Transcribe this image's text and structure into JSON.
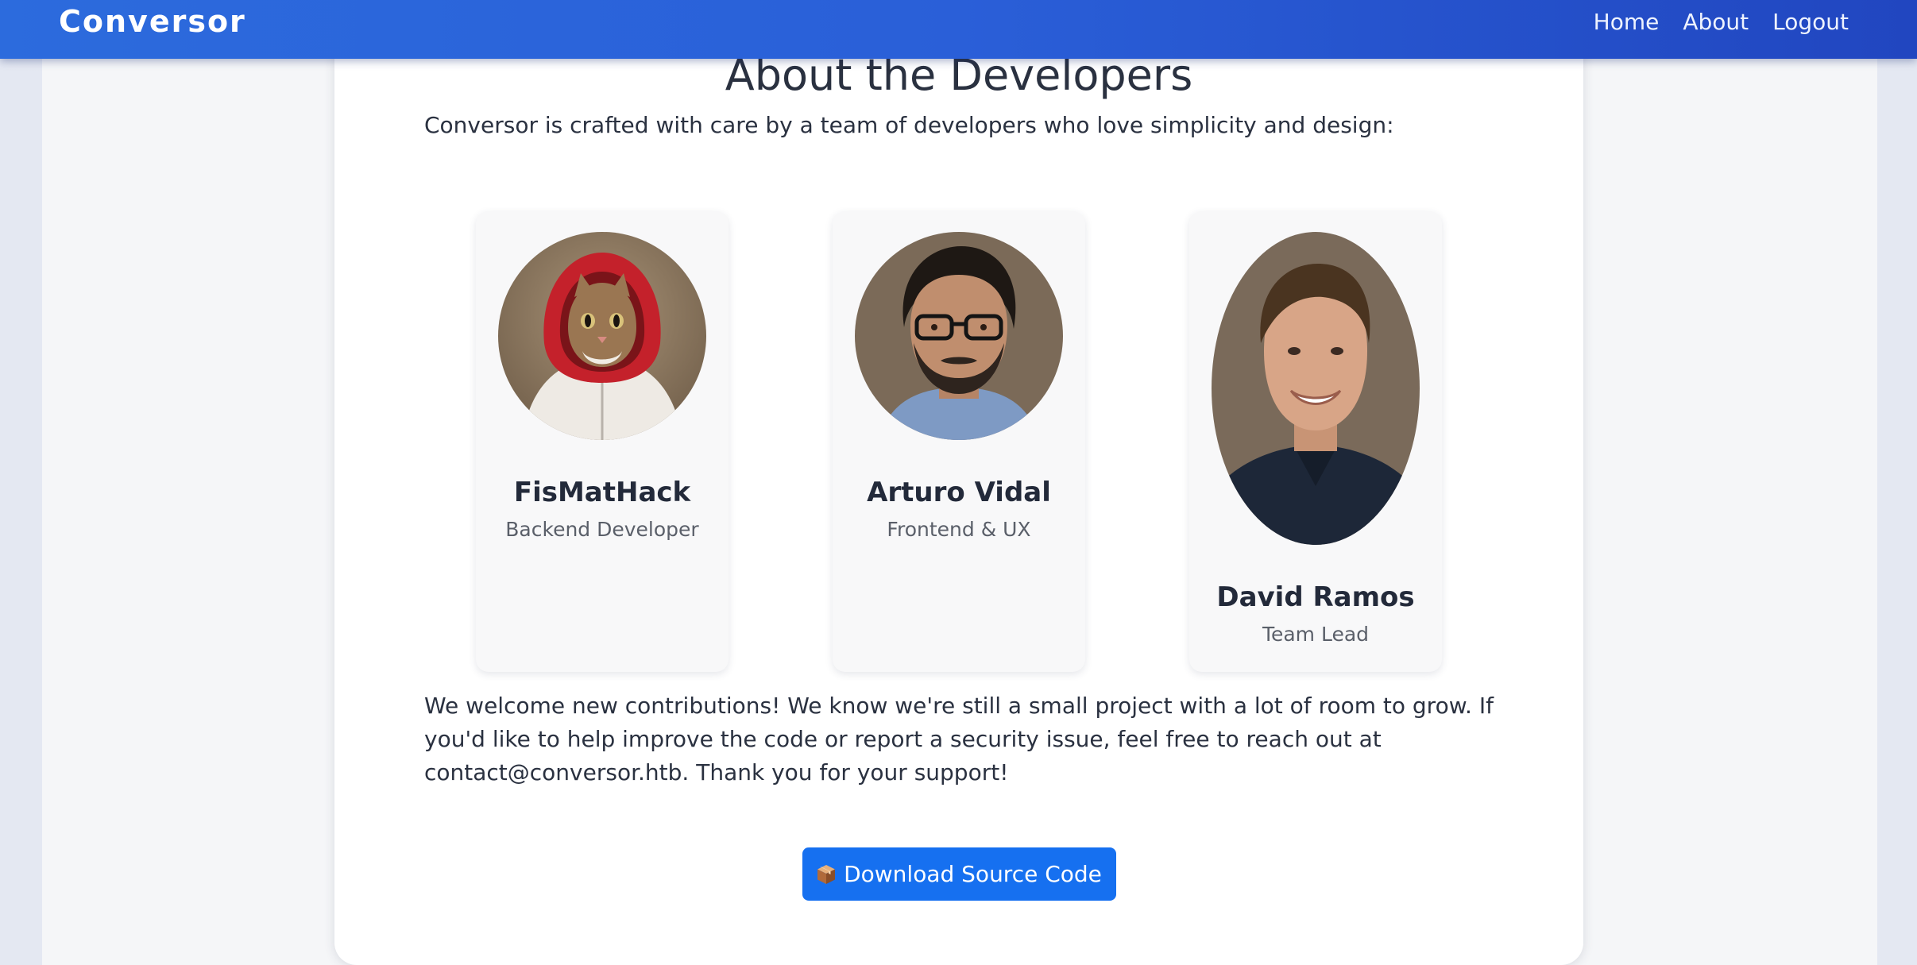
{
  "navbar": {
    "brand": "Conversor",
    "links": [
      "Home",
      "About",
      "Logout"
    ]
  },
  "main": {
    "title": "About the Developers",
    "intro": "Conversor is crafted with care by a team of developers who love simplicity and design:",
    "developers": [
      {
        "name": "FisMatHack",
        "role": "Backend Developer",
        "avatar_icon": "cat-in-red-hoodie-photo"
      },
      {
        "name": "Arturo Vidal",
        "role": "Frontend & UX",
        "avatar_icon": "man-with-glasses-photo"
      },
      {
        "name": "David Ramos",
        "role": "Team Lead",
        "avatar_icon": "smiling-man-photo"
      }
    ],
    "contribution_text": "We welcome new contributions! We know we're still a small project with a lot of room to grow. If you'd like to help improve the code or report a security issue, feel free to reach out at contact@conversor.htb. Thank you for your support!",
    "download_button": {
      "icon": "package-icon",
      "label": "Download Source Code"
    }
  },
  "colors": {
    "navbar_start": "#2c6bdd",
    "navbar_end": "#2146c0",
    "button": "#1670f0",
    "text": "#2a3140"
  }
}
